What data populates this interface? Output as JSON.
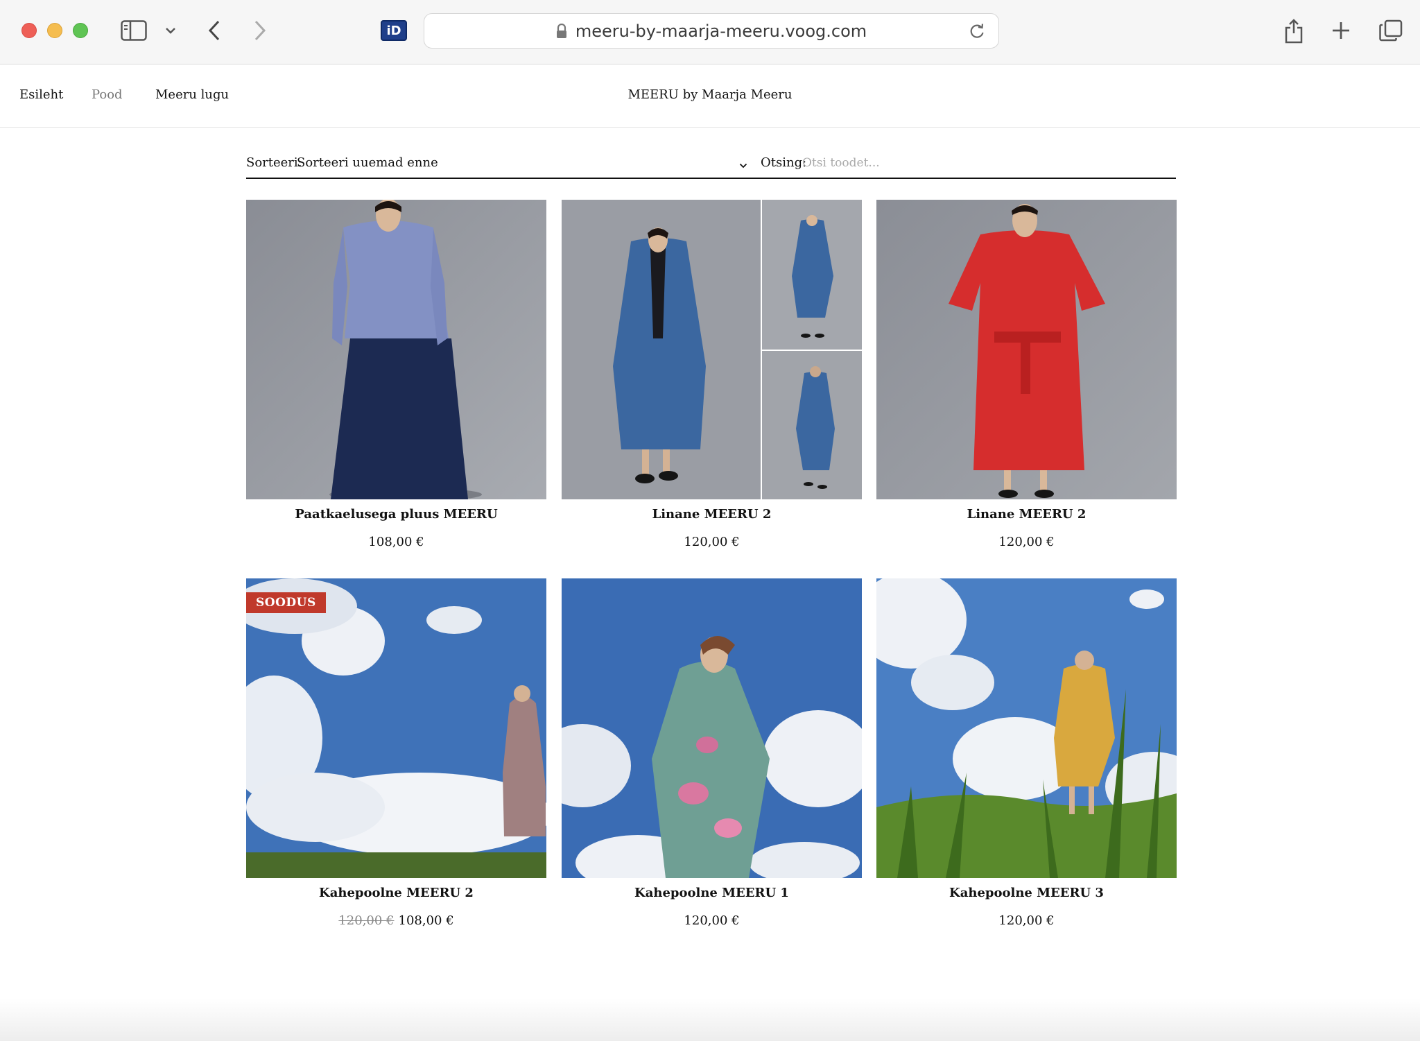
{
  "browser": {
    "url": "meeru-by-maarja-meeru.voog.com",
    "extension_label": "iD"
  },
  "site": {
    "title": "MEERU by Maarja Meeru",
    "nav": [
      {
        "label": "Esileht",
        "active": false
      },
      {
        "label": "Pood",
        "active": true
      },
      {
        "label": "Meeru lugu",
        "active": false
      }
    ]
  },
  "filters": {
    "sort_label": "Sorteeri:",
    "sort_value": "Sorteeri uuemad enne",
    "search_label": "Otsing:",
    "search_placeholder": "Otsi toodet..."
  },
  "products": [
    {
      "name": "Paatkaelusega pluus MEERU",
      "price": "108,00 €",
      "old_price": "",
      "badge": "",
      "photo": "studio-model-blue-top-navy-skirt"
    },
    {
      "name": "Linane MEERU 2",
      "price": "120,00 €",
      "old_price": "",
      "badge": "",
      "photo": "studio-model-blue-linen-coat-collage"
    },
    {
      "name": "Linane MEERU 2",
      "price": "120,00 €",
      "old_price": "",
      "badge": "",
      "photo": "studio-model-red-linen-dress"
    },
    {
      "name": "Kahepoolne MEERU 2",
      "price": "108,00 €",
      "old_price": "120,00 €",
      "badge": "SOODUS",
      "photo": "sky-model-mauve-robe"
    },
    {
      "name": "Kahepoolne MEERU 1",
      "price": "120,00 €",
      "old_price": "",
      "badge": "",
      "photo": "sky-model-floral-robe"
    },
    {
      "name": "Kahepoolne MEERU 3",
      "price": "120,00 €",
      "old_price": "",
      "badge": "",
      "photo": "sky-model-yellow-robe-grass"
    }
  ],
  "colors": {
    "sale_badge": "#c0392b",
    "studio_backdrop": "#8f939c",
    "sky": "#3f72b8"
  }
}
